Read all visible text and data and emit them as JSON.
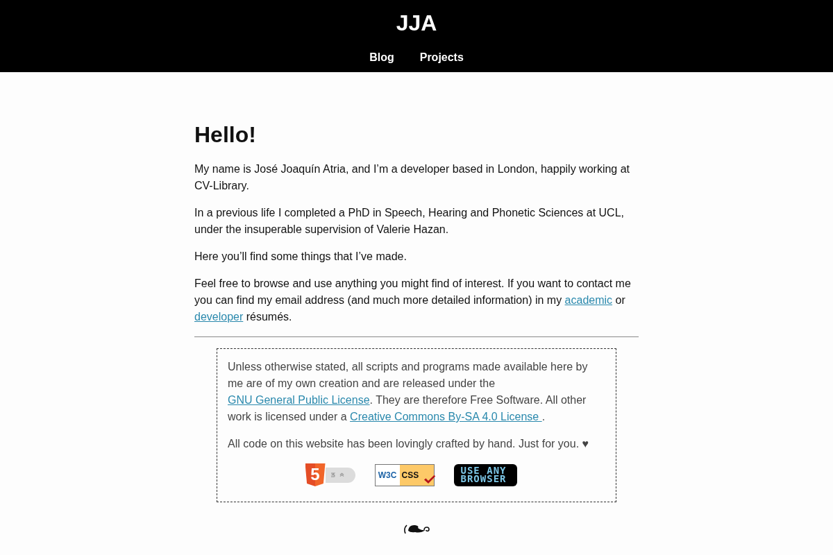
{
  "header": {
    "title": "JJA",
    "nav": [
      {
        "label": "Blog"
      },
      {
        "label": "Projects"
      }
    ]
  },
  "intro": {
    "heading": "Hello!",
    "paragraphs": [
      {
        "parts": [
          {
            "kind": "text",
            "text": "My name is José Joaquín Atria, and I’m a developer based in London, happily working at CV-Library."
          }
        ]
      },
      {
        "parts": [
          {
            "kind": "text",
            "text": "In a previous life I completed a PhD in Speech, Hearing and Phonetic Sciences at UCL, under the insuperable supervision of Valerie Hazan."
          }
        ]
      },
      {
        "parts": [
          {
            "kind": "text",
            "text": "Here you’ll find some things that I’ve made."
          }
        ]
      },
      {
        "parts": [
          {
            "kind": "text",
            "text": "Feel free to browse and use anything you might find of interest. If you want to contact me you can find my email address (and much more detailed information) in my "
          },
          {
            "kind": "link",
            "text": "academic"
          },
          {
            "kind": "text",
            "text": " or "
          },
          {
            "kind": "link",
            "text": "developer"
          },
          {
            "kind": "text",
            "text": " résumés."
          }
        ]
      }
    ]
  },
  "notice": {
    "paragraphs": [
      {
        "parts": [
          {
            "kind": "text",
            "text": "Unless otherwise stated, all scripts and programs made available here by me are of my own creation and are released under the "
          },
          {
            "kind": "link",
            "text": "GNU General Public License"
          },
          {
            "kind": "text",
            "text": ". They are therefore Free Software. All other work is licensed under a "
          },
          {
            "kind": "link",
            "text": "Creative Commons By-SA 4.0 License "
          },
          {
            "kind": "text",
            "text": "."
          }
        ]
      },
      {
        "parts": [
          {
            "kind": "text",
            "text": "All code on this website has been lovingly crafted by hand. Just for you. ♥"
          }
        ]
      }
    ],
    "badges": [
      {
        "kind": "html5",
        "text": "5"
      },
      {
        "kind": "css",
        "texts": [
          "W3C",
          "CSS"
        ]
      },
      {
        "kind": "browser",
        "text": "USE ANY BROWSER"
      }
    ]
  }
}
